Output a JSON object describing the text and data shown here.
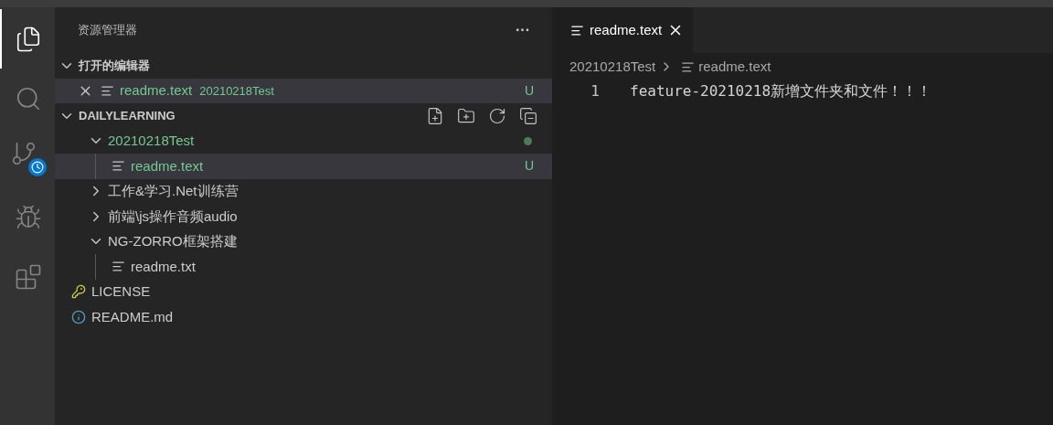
{
  "activity_bar": [
    {
      "kind": "files",
      "selected": true
    },
    {
      "kind": "search",
      "selected": false
    },
    {
      "kind": "git",
      "selected": false
    },
    {
      "kind": "debug",
      "selected": false
    },
    {
      "kind": "extensions",
      "selected": false
    }
  ],
  "sidebar": {
    "title": "资源管理器",
    "more": "···",
    "open_editors": {
      "title": "打开的编辑器",
      "expanded": true,
      "items": [
        {
          "name": "readme.text",
          "folder": "20210218Test",
          "status": "U",
          "untracked": true,
          "selected": true
        }
      ]
    },
    "workspace": {
      "title": "DAILYLEARNING",
      "expanded": true,
      "items": [
        {
          "kind": "folder",
          "name": "20210218Test",
          "expanded": true,
          "untracked": true,
          "dot": true,
          "selected": false,
          "children": [
            {
              "kind": "file",
              "name": "readme.text",
              "untracked": true,
              "status": "U",
              "selected": true
            }
          ]
        },
        {
          "kind": "folder",
          "name": "工作&学习.Net训练营",
          "expanded": false,
          "untracked": false,
          "dot": false,
          "selected": false
        },
        {
          "kind": "folder",
          "name": "前端\\js操作音频audio",
          "expanded": false,
          "untracked": false,
          "dot": false,
          "selected": false
        },
        {
          "kind": "folder",
          "name": "NG-ZORRO框架搭建",
          "expanded": true,
          "untracked": false,
          "dot": false,
          "selected": false,
          "children": [
            {
              "kind": "file",
              "name": "readme.txt",
              "untracked": false,
              "selected": false
            }
          ]
        },
        {
          "kind": "license",
          "name": "LICENSE",
          "untracked": false,
          "selected": false
        },
        {
          "kind": "info",
          "name": "README.md",
          "untracked": false,
          "selected": false
        }
      ]
    }
  },
  "editor": {
    "tabs": [
      {
        "label": "readme.text",
        "selected": true
      }
    ],
    "breadcrumb": [
      "20210218Test",
      "readme.text"
    ],
    "lines": [
      {
        "number": "1",
        "text": "feature-20210218新增文件夹和文件！！！"
      }
    ]
  }
}
